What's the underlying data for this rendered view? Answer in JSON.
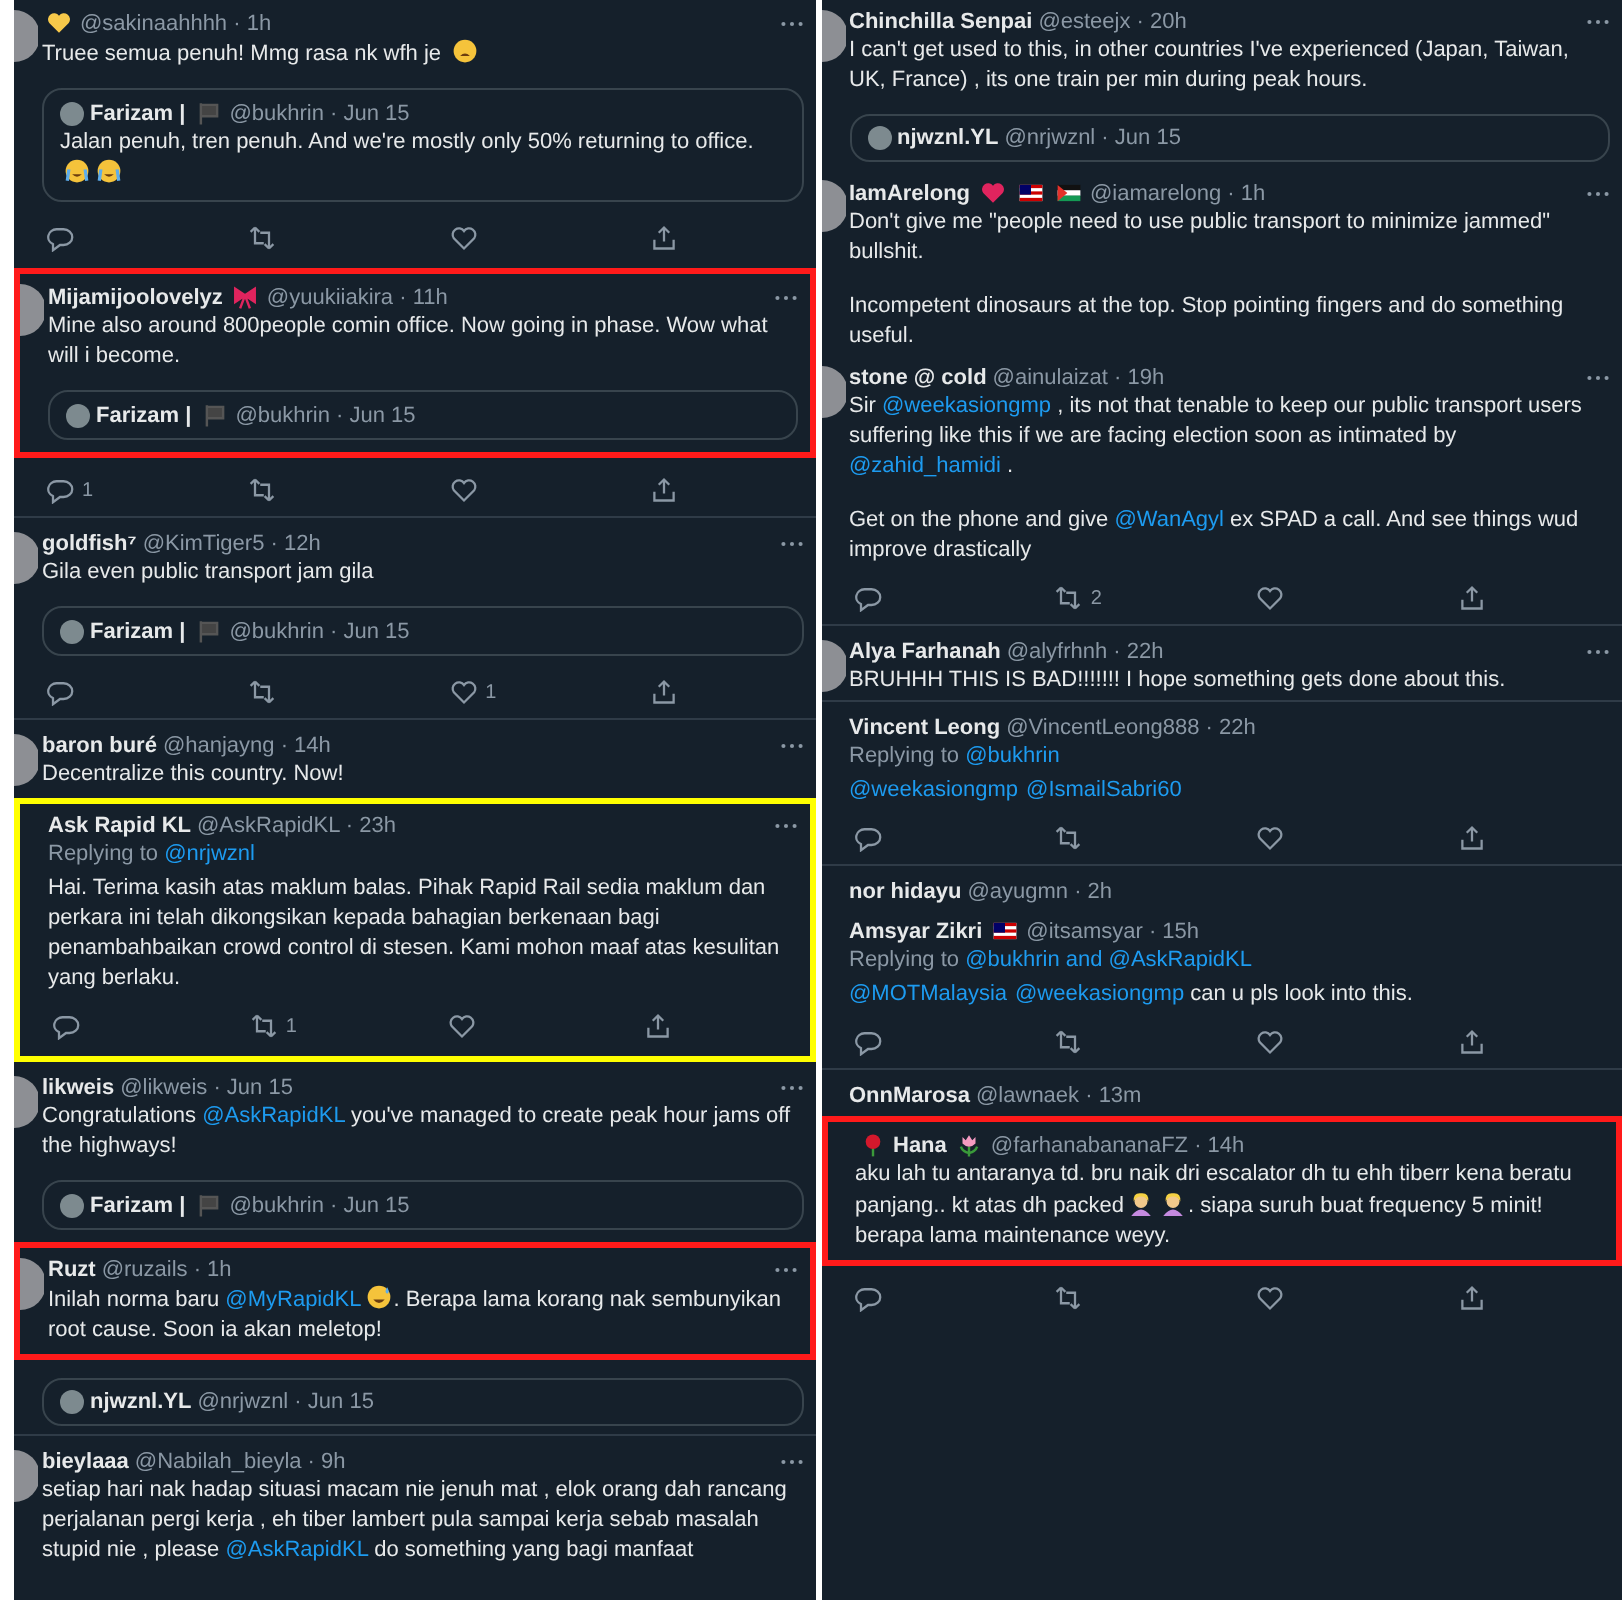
{
  "columns": [
    {
      "items": [
        {
          "kind": "tweet",
          "avatar": true,
          "more": true,
          "badges": [
            {
              "kind": "heart",
              "color": "#f7c94a"
            }
          ],
          "meta": "@sakinaahhhh · 1h",
          "paragraphs": [
            [
              {
                "kind": "plain",
                "t": "Truee semua penuh! Mmg rasa nk wfh je "
              },
              {
                "kind": "weary"
              }
            ]
          ]
        },
        {
          "kind": "quote",
          "name": "Farizam |",
          "badges": [
            {
              "kind": "flag"
            }
          ],
          "meta": "@bukhrin · Jun 15",
          "paragraphs": [
            [
              {
                "kind": "plain",
                "t": "Jalan penuh, tren penuh. And we're mostly only 50% returning to office. "
              },
              {
                "kind": "crying"
              },
              {
                "kind": "crying"
              }
            ]
          ]
        },
        {
          "kind": "actions",
          "buttons": [
            {
              "kind": "reply"
            },
            {
              "kind": "retweet"
            },
            {
              "kind": "like"
            },
            {
              "kind": "share"
            }
          ]
        },
        {
          "kind": "frame",
          "color": "#ff1a1a",
          "items": [
            {
              "kind": "tweet",
              "avatar": true,
              "more": true,
              "name": "Mijamijoolovelyz",
              "badges": [
                {
                  "kind": "bow"
                }
              ],
              "meta": "@yuukiiakira · 11h",
              "paragraphs": [
                [
                  {
                    "kind": "plain",
                    "t": "Mine also around 800people comin office. Now going in phase. Wow what will i become."
                  }
                ]
              ]
            },
            {
              "kind": "quote",
              "name": "Farizam |",
              "badges": [
                {
                  "kind": "flag"
                }
              ],
              "meta": "@bukhrin · Jun 15"
            }
          ]
        },
        {
          "kind": "actions",
          "buttons": [
            {
              "kind": "reply",
              "count": "1"
            },
            {
              "kind": "retweet"
            },
            {
              "kind": "like"
            },
            {
              "kind": "share"
            }
          ]
        },
        {
          "kind": "tweet",
          "avatar": true,
          "more": true,
          "divider": true,
          "name": "goldfish⁷",
          "meta": "@KimTiger5 · 12h",
          "paragraphs": [
            [
              {
                "kind": "plain",
                "t": "Gila even public transport jam gila"
              }
            ]
          ]
        },
        {
          "kind": "quote",
          "name": "Farizam |",
          "badges": [
            {
              "kind": "flag"
            }
          ],
          "meta": "@bukhrin · Jun 15"
        },
        {
          "kind": "actions",
          "buttons": [
            {
              "kind": "reply"
            },
            {
              "kind": "retweet"
            },
            {
              "kind": "like",
              "count": "1"
            },
            {
              "kind": "share"
            }
          ]
        },
        {
          "kind": "tweet",
          "avatar": true,
          "more": true,
          "divider": true,
          "name": "baron buré",
          "meta": "@hanjayng · 14h",
          "paragraphs": [
            [
              {
                "kind": "plain",
                "t": "Decentralize this country. Now!"
              }
            ]
          ]
        },
        {
          "kind": "frame",
          "color": "#ffff00",
          "items": [
            {
              "kind": "tweet",
              "avatar": false,
              "more": true,
              "name": "Ask Rapid KL",
              "meta": "@AskRapidKL · 23h",
              "replying": [
                {
                  "kind": "plain",
                  "t": "Replying to "
                },
                {
                  "kind": "mention",
                  "t": "@nrjwznl"
                }
              ],
              "paragraphs": [
                [
                  {
                    "kind": "plain",
                    "t": "Hai. Terima kasih atas maklum balas. Pihak Rapid Rail sedia maklum dan perkara ini telah dikongsikan kepada bahagian berkenaan bagi penambahbaikan crowd control di stesen. Kami mohon maaf atas kesulitan yang berlaku."
                  }
                ]
              ]
            },
            {
              "kind": "actions",
              "buttons": [
                {
                  "kind": "reply"
                },
                {
                  "kind": "retweet",
                  "count": "1"
                },
                {
                  "kind": "like"
                },
                {
                  "kind": "share"
                }
              ]
            }
          ]
        },
        {
          "kind": "tweet",
          "avatar": true,
          "more": true,
          "name": "likweis",
          "meta": "@likweis · Jun 15",
          "paragraphs": [
            [
              {
                "kind": "plain",
                "t": "Congratulations "
              },
              {
                "kind": "mention",
                "t": "@AskRapidKL"
              },
              {
                "kind": "plain",
                "t": " you've managed to create peak hour jams off the highways!"
              }
            ]
          ]
        },
        {
          "kind": "quote",
          "name": "Farizam |",
          "badges": [
            {
              "kind": "flag"
            }
          ],
          "meta": "@bukhrin · Jun 15"
        },
        {
          "kind": "frame",
          "color": "#ff1a1a",
          "items": [
            {
              "kind": "tweet",
              "avatar": true,
              "more": true,
              "name": "Ruzt",
              "meta": "@ruzails · 1h",
              "paragraphs": [
                [
                  {
                    "kind": "plain",
                    "t": "Inilah norma baru "
                  },
                  {
                    "kind": "mention",
                    "t": "@MyRapidKL"
                  },
                  {
                    "kind": "grin"
                  },
                  {
                    "kind": "plain",
                    "t": ". Berapa lama korang nak sembunyikan root cause. Soon ia akan meletop!"
                  }
                ]
              ]
            }
          ]
        },
        {
          "kind": "quote",
          "name": "njwznl.YL",
          "meta": "@nrjwznl · Jun 15"
        },
        {
          "kind": "tweet",
          "avatar": true,
          "more": true,
          "divider": true,
          "name": "bieylaaa",
          "meta": "@Nabilah_bieyla · 9h",
          "paragraphs": [
            [
              {
                "kind": "plain",
                "t": "setiap hari nak hadap situasi macam nie jenuh mat , elok orang dah rancang perjalanan pergi kerja , eh tiber lambert pula sampai kerja sebab masalah stupid nie , please "
              },
              {
                "kind": "mention",
                "t": "@AskRapidKL"
              },
              {
                "kind": "plain",
                "t": " do something yang bagi manfaat"
              }
            ]
          ]
        }
      ]
    },
    {
      "items": [
        {
          "kind": "tweet",
          "avatar": true,
          "more": true,
          "name": "Chinchilla Senpai",
          "meta": "@esteejx · 20h",
          "paragraphs": [
            [
              {
                "kind": "plain",
                "t": "I can't get used to this, in other countries I've experienced (Japan, Taiwan, UK, France) , its one train per min during peak hours."
              }
            ]
          ]
        },
        {
          "kind": "quote",
          "name": "njwznl.YL",
          "meta": "@nrjwznl · Jun 15"
        },
        {
          "kind": "tweet",
          "avatar": true,
          "more": true,
          "name": "IamArelong",
          "badges": [
            {
              "kind": "heart",
              "color": "#e0245e"
            },
            {
              "kind": "stripes"
            },
            {
              "kind": "tricolor"
            }
          ],
          "meta": "@iamarelong · 1h",
          "paragraphs": [
            [
              {
                "kind": "plain",
                "t": "Don't give me \"people need to use public transport to minimize jammed\" bullshit."
              }
            ],
            [
              {
                "kind": "plain",
                "t": "Incompetent dinosaurs at the top. Stop pointing fingers and do something useful."
              }
            ]
          ]
        },
        {
          "kind": "tweet",
          "avatar": true,
          "more": true,
          "name": "stone @ cold",
          "meta": "@ainulaizat · 19h",
          "paragraphs": [
            [
              {
                "kind": "plain",
                "t": "Sir "
              },
              {
                "kind": "mention",
                "t": "@weekasiongmp"
              },
              {
                "kind": "plain",
                "t": " , its not that tenable to keep our public transport users suffering like this if we are facing election soon as intimated by "
              },
              {
                "kind": "mention",
                "t": "@zahid_hamidi"
              },
              {
                "kind": "plain",
                "t": " ."
              }
            ],
            [
              {
                "kind": "plain",
                "t": "Get on the phone and give "
              },
              {
                "kind": "mention",
                "t": "@WanAgyl"
              },
              {
                "kind": "plain",
                "t": " ex SPAD a call. And see things wud improve drastically"
              }
            ]
          ]
        },
        {
          "kind": "actions",
          "buttons": [
            {
              "kind": "reply"
            },
            {
              "kind": "retweet",
              "count": "2"
            },
            {
              "kind": "like"
            },
            {
              "kind": "share"
            }
          ]
        },
        {
          "kind": "tweet",
          "avatar": true,
          "more": true,
          "divider": true,
          "name": "Alya Farhanah",
          "meta": "@alyfrhnh · 22h",
          "paragraphs": [
            [
              {
                "kind": "plain",
                "t": "BRUHHH THIS IS BAD!!!!!!! I hope something gets done about this."
              }
            ]
          ]
        },
        {
          "kind": "tweet",
          "avatar": false,
          "more": false,
          "divider": true,
          "name": "Vincent Leong",
          "meta": "@VincentLeong888 · 22h",
          "replying": [
            {
              "kind": "plain",
              "t": "Replying to "
            },
            {
              "kind": "mention",
              "t": "@bukhrin"
            }
          ],
          "paragraphs": [
            [
              {
                "kind": "mention",
                "t": "@weekasiongmp"
              },
              {
                "kind": "mention",
                "t": "@IsmailSabri60"
              }
            ]
          ]
        },
        {
          "kind": "actions",
          "buttons": [
            {
              "kind": "reply"
            },
            {
              "kind": "retweet"
            },
            {
              "kind": "like"
            },
            {
              "kind": "share"
            }
          ]
        },
        {
          "kind": "tweet",
          "avatar": false,
          "more": false,
          "divider": true,
          "name": "nor hidayu",
          "meta": "@ayugmn · 2h"
        },
        {
          "kind": "tweet",
          "avatar": false,
          "more": false,
          "name": "Amsyar Zikri",
          "badges": [
            {
              "kind": "stripes"
            }
          ],
          "meta": "@itsamsyar · 15h",
          "replying": [
            {
              "kind": "plain",
              "t": "Replying to "
            },
            {
              "kind": "mention",
              "t": "@bukhrin and @AskRapidKL"
            }
          ],
          "paragraphs": [
            [
              {
                "kind": "mention",
                "t": "@MOTMalaysia"
              },
              {
                "kind": "mention",
                "t": "@weekasiongmp"
              },
              {
                "kind": "plain",
                "t": " can u pls look into this."
              }
            ]
          ]
        },
        {
          "kind": "actions",
          "buttons": [
            {
              "kind": "reply"
            },
            {
              "kind": "retweet"
            },
            {
              "kind": "like"
            },
            {
              "kind": "share"
            }
          ]
        },
        {
          "kind": "tweet",
          "avatar": false,
          "more": false,
          "divider": true,
          "name": "OnnMarosa",
          "meta": "@lawnaek · 13m"
        },
        {
          "kind": "frame",
          "color": "#ff1a1a",
          "items": [
            {
              "kind": "tweet",
              "avatar": false,
              "more": false,
              "badges_before": [
                {
                  "kind": "rose"
                }
              ],
              "name": "Hana",
              "badges": [
                {
                  "kind": "tulip"
                }
              ],
              "meta": "@farhanabananaFZ · 14h",
              "paragraphs": [
                [
                  {
                    "kind": "plain",
                    "t": "aku lah tu antaranya td. bru naik dri escalator dh tu ehh tiberr kena beratu panjang.. kt atas dh packed"
                  },
                  {
                    "kind": "person"
                  },
                  {
                    "kind": "person"
                  },
                  {
                    "kind": "plain",
                    "t": ". siapa suruh buat frequency 5 minit! berapa lama maintenance weyy."
                  }
                ]
              ]
            }
          ]
        },
        {
          "kind": "actions",
          "buttons": [
            {
              "kind": "reply"
            },
            {
              "kind": "retweet"
            },
            {
              "kind": "like"
            },
            {
              "kind": "share"
            }
          ]
        }
      ]
    }
  ]
}
